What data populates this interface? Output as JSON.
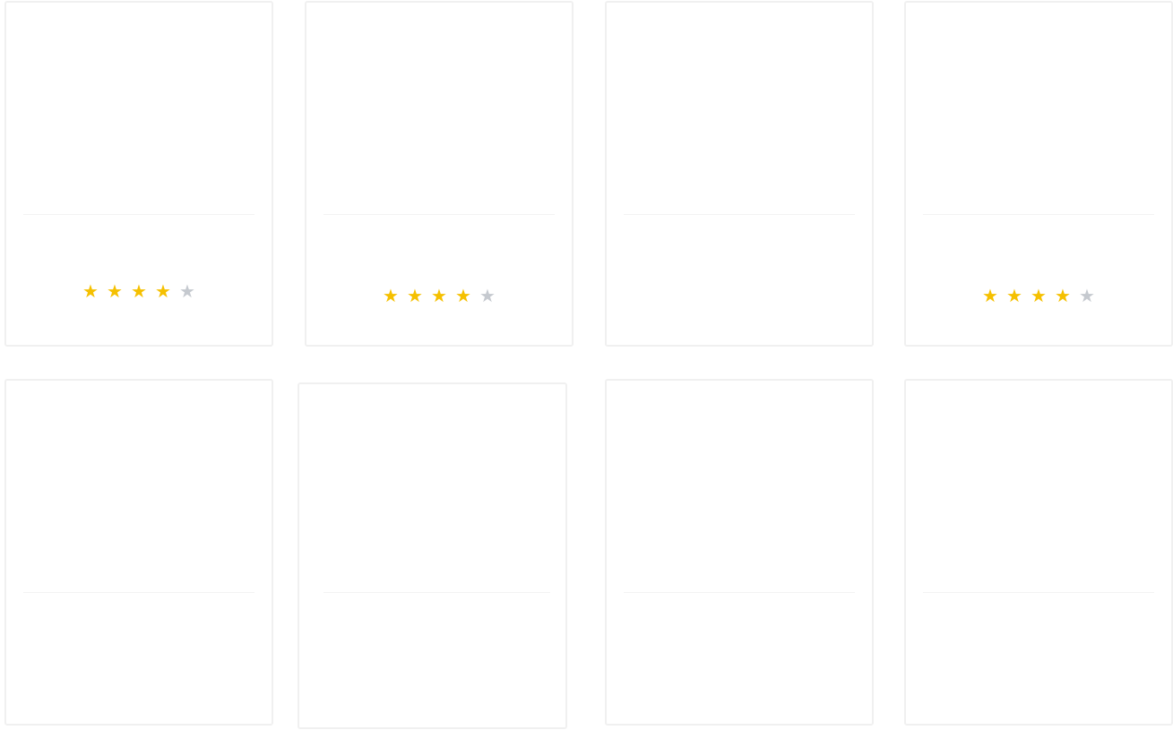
{
  "colors": {
    "star_filled": "#f5c000",
    "star_empty": "#c5c9cf",
    "card_border": "#f0f0f0"
  },
  "star_glyph": "★",
  "products": [
    {
      "rating": 4,
      "max_rating": 5
    },
    {
      "rating": 4,
      "max_rating": 5
    },
    {
      "rating": null
    },
    {
      "rating": 4,
      "max_rating": 5
    },
    {
      "rating": null
    },
    {
      "rating": null
    },
    {
      "rating": null
    },
    {
      "rating": null
    }
  ]
}
